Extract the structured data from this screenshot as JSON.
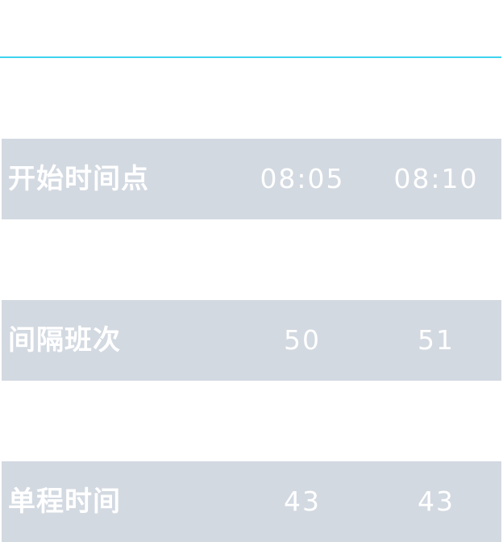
{
  "rows": [
    {
      "label": "开始时间点",
      "values": [
        "08:05",
        "08:10"
      ]
    },
    {
      "label": "间隔班次",
      "values": [
        "50",
        "51"
      ]
    },
    {
      "label": "单程时间",
      "values": [
        "43",
        "43"
      ]
    }
  ],
  "colors": {
    "accent_line": "#3fd4ef",
    "band": "#d3d9e1",
    "text": "#ffffff",
    "background": "#ffffff"
  }
}
